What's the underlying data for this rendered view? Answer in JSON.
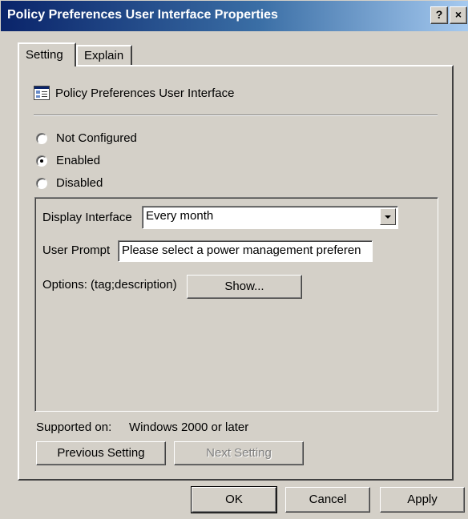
{
  "window": {
    "title": "Policy Preferences User Interface Properties",
    "help_label": "?",
    "close_label": "×"
  },
  "tabs": [
    {
      "label": "Setting",
      "selected": true
    },
    {
      "label": "Explain",
      "selected": false
    }
  ],
  "policy": {
    "icon": "policy-setting-icon",
    "name": "Policy Preferences User Interface"
  },
  "state": {
    "options": [
      {
        "label": "Not Configured",
        "checked": false
      },
      {
        "label": "Enabled",
        "checked": true
      },
      {
        "label": "Disabled",
        "checked": false
      }
    ]
  },
  "settings": {
    "display_interface_label": "Display Interface",
    "display_interface_value": "Every month",
    "user_prompt_label": "User Prompt",
    "user_prompt_value": "Please select a power management preferen",
    "options_label": "Options: (tag;description)",
    "show_button": "Show..."
  },
  "supported": {
    "label": "Supported on:",
    "value": "Windows 2000 or later"
  },
  "nav": {
    "previous": "Previous Setting",
    "next": "Next Setting"
  },
  "footer": {
    "ok": "OK",
    "cancel": "Cancel",
    "apply": "Apply"
  }
}
